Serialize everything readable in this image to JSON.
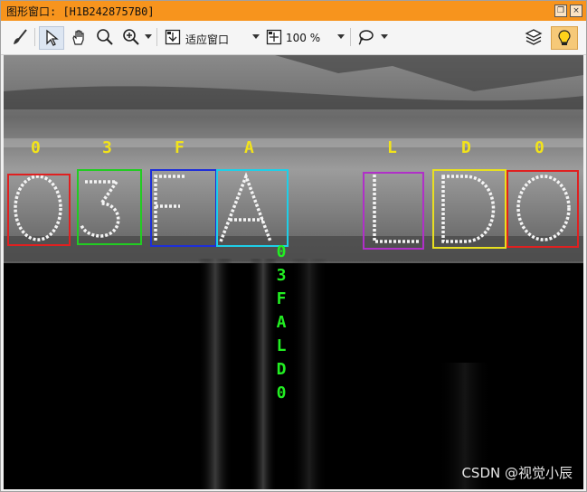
{
  "window": {
    "title": "图形窗口: [H1B2428757B0]",
    "title_buttons": [
      "restore-icon",
      "close-icon"
    ]
  },
  "toolbar": {
    "tools": [
      "brush-icon",
      "pointer-icon",
      "hand-icon",
      "zoom-icon",
      "zoom-in-icon",
      "fit-window-icon",
      "zoom-level-icon",
      "lasso-icon",
      "layers-icon",
      "lightbulb-icon"
    ],
    "fit_label": "适应窗口",
    "zoom_value": "100 %"
  },
  "ocr": {
    "top_labels": [
      "0",
      "3",
      "F",
      "A",
      "L",
      "D",
      "0"
    ],
    "box_colors": [
      "#e02020",
      "#22cc22",
      "#1e2fd8",
      "#1ecfe8",
      "#b030c8",
      "#e8e020",
      "#e02020"
    ],
    "label_color": "#f2e31a",
    "vertical_result": [
      "0",
      "3",
      "F",
      "A",
      "L",
      "D",
      "0"
    ]
  },
  "watermark": "CSDN @视觉小辰"
}
